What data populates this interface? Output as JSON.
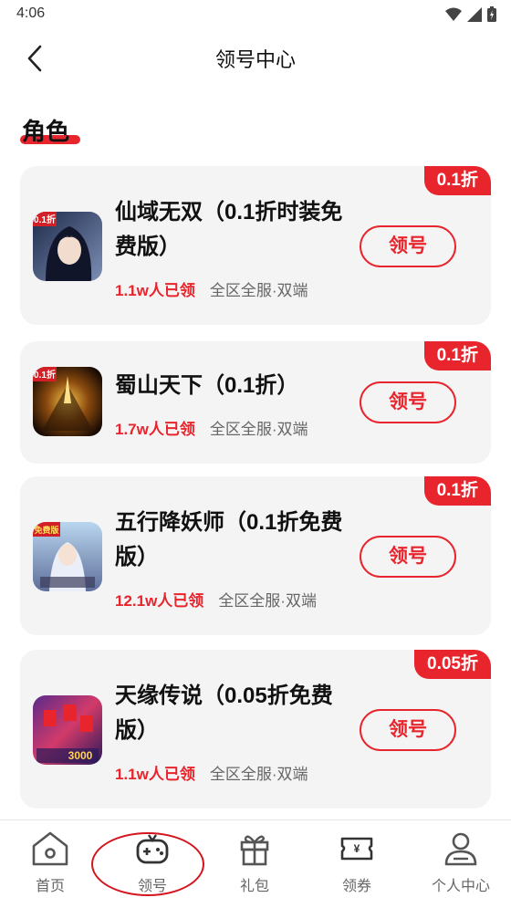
{
  "status": {
    "time": "4:06"
  },
  "header": {
    "title": "领号中心"
  },
  "section": {
    "title": "角色"
  },
  "games": [
    {
      "badge": "0.1折",
      "name": "仙域无双（0.1折时装免费版）",
      "count": "1.1w人已领",
      "scope": "全区全服·双端",
      "button": "领号",
      "icon_label": "0.1折"
    },
    {
      "badge": "0.1折",
      "name": "蜀山天下（0.1折）",
      "count": "1.7w人已领",
      "scope": "全区全服·双端",
      "button": "领号",
      "icon_label": "0.1折"
    },
    {
      "badge": "0.1折",
      "name": "五行降妖师（0.1折免费版）",
      "count": "12.1w人已领",
      "scope": "全区全服·双端",
      "button": "领号",
      "icon_label": "免费版"
    },
    {
      "badge": "0.05折",
      "name": "天缘传说（0.05折免费版）",
      "count": "1.1w人已领",
      "scope": "全区全服·双端",
      "button": "领号",
      "icon_label": "3000"
    }
  ],
  "tabbar": {
    "items": [
      {
        "label": "首页",
        "icon": "home-icon"
      },
      {
        "label": "领号",
        "icon": "gamepad-icon"
      },
      {
        "label": "礼包",
        "icon": "gift-icon"
      },
      {
        "label": "领券",
        "icon": "coupon-icon"
      },
      {
        "label": "个人中心",
        "icon": "user-icon"
      }
    ]
  },
  "colors": {
    "accent": "#e8242c",
    "card_bg": "#f4f4f4",
    "text": "#111111",
    "muted": "#666666"
  }
}
